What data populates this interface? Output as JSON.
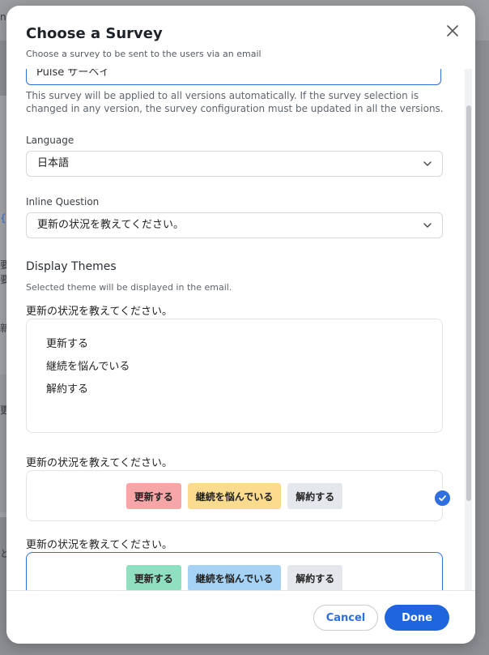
{
  "background": {
    "glyphs": [
      "ne",
      "{",
      "要",
      "要",
      "新",
      "更",
      "と"
    ]
  },
  "modal": {
    "title": "Choose a Survey",
    "subtitle": "Choose a survey to be sent to the users via an email",
    "survey_input_value": "Pulse サーベイ",
    "helper_text": "This survey will be applied to all versions automatically. If the survey selection is changed in any version, the survey configuration must be updated in all the versions.",
    "language": {
      "label": "Language",
      "value": "日本語"
    },
    "inline_question": {
      "label": "Inline Question",
      "value": "更新の状況を教えてください。"
    },
    "display_themes": {
      "title": "Display Themes",
      "description": "Selected theme will be displayed in the email.",
      "themes": [
        {
          "question": "更新の状況を教えてください。",
          "options": [
            "更新する",
            "継続を悩んでいる",
            "解約する"
          ]
        },
        {
          "question": "更新の状況を教えてください。",
          "options": [
            "更新する",
            "継続を悩んでいる",
            "解約する"
          ],
          "colors": [
            "#f6a6a6",
            "#fbdc8e",
            "#e4e7ec"
          ]
        },
        {
          "question": "更新の状況を教えてください。",
          "options": [
            "更新する",
            "継続を悩んでいる",
            "解約する"
          ],
          "colors": [
            "#8fe0c0",
            "#a6d3f5",
            "#e4e7ec"
          ],
          "selected": true
        }
      ]
    },
    "footer": {
      "cancel_label": "Cancel",
      "done_label": "Done"
    }
  },
  "colors": {
    "accent": "#1f66de",
    "selected_border": "#2f6fe0"
  }
}
